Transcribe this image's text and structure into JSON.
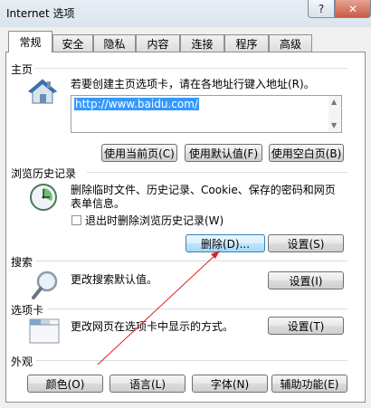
{
  "window": {
    "title": "Internet 选项",
    "help_glyph": "?",
    "close_glyph": "✕"
  },
  "tabs": [
    "常规",
    "安全",
    "隐私",
    "内容",
    "连接",
    "程序",
    "高级"
  ],
  "home": {
    "group": "主页",
    "desc": "若要创建主页选项卡，请在各地址行键入地址(R)。",
    "url": "http://www.baidu.com/",
    "buttons": [
      "使用当前页(C)",
      "使用默认值(F)",
      "使用空白页(B)"
    ]
  },
  "history": {
    "group": "浏览历史记录",
    "desc_line1": "删除临时文件、历史记录、Cookie、保存的密码和网页",
    "desc_line2": "表单信息。",
    "checkbox_label": "退出时删除浏览历史记录(W)",
    "delete_button": "删除(D)...",
    "settings_button": "设置(S)"
  },
  "search": {
    "group": "搜索",
    "desc": "更改搜索默认值。",
    "settings_button": "设置(I)"
  },
  "tabs_section": {
    "group": "选项卡",
    "desc": "更改网页在选项卡中显示的方式。",
    "settings_button": "设置(T)"
  },
  "appearance": {
    "group": "外观",
    "buttons": [
      "颜色(O)",
      "语言(L)",
      "字体(N)",
      "辅助功能(E)"
    ]
  },
  "colors": {
    "annotation_arrow": "#e02020",
    "selection": "#3399ff"
  }
}
